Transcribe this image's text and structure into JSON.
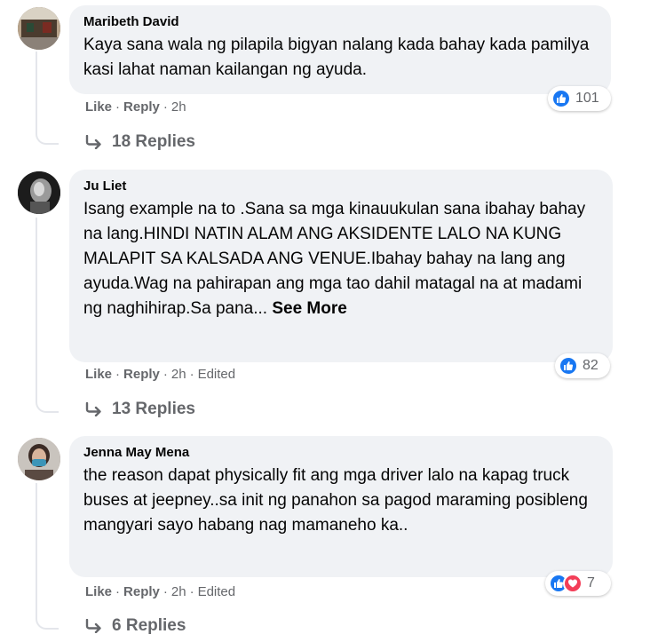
{
  "comments": [
    {
      "author": "Maribeth David",
      "text": "Kaya sana wala ng pilapila bigyan nalang kada bahay kada pamilya kasi lahat naman kailangan ng ayuda.",
      "see_more": "",
      "reactions": {
        "types": [
          "like"
        ],
        "count": "101"
      },
      "actions": {
        "like": "Like",
        "reply": "Reply",
        "time": "2h",
        "edited": ""
      },
      "replies": "18 Replies"
    },
    {
      "author": "Ju Liet",
      "text": "Isang example na to .Sana sa mga kinauukulan sana ibahay bahay na lang.HINDI NATIN ALAM ANG AKSIDENTE LALO NA KUNG MALAPIT SA KALSADA ANG VENUE.Ibahay bahay na lang ang ayuda.Wag na pahirapan ang mga tao dahil matagal na at madami ng naghihirap.Sa pana...",
      "see_more": "See More",
      "reactions": {
        "types": [
          "like"
        ],
        "count": "82"
      },
      "actions": {
        "like": "Like",
        "reply": "Reply",
        "time": "2h",
        "edited": "Edited"
      },
      "replies": "13 Replies"
    },
    {
      "author": "Jenna May Mena",
      "text": "the reason dapat physically fit ang mga driver lalo na kapag truck buses at jeepney..sa init ng panahon sa pagod maraming posibleng mangyari sayo habang nag mamaneho ka..",
      "see_more": "",
      "reactions": {
        "types": [
          "like",
          "love"
        ],
        "count": "7"
      },
      "actions": {
        "like": "Like",
        "reply": "Reply",
        "time": "2h",
        "edited": "Edited"
      },
      "replies": "6 Replies"
    }
  ],
  "colors": {
    "bubble": "#f0f2f5",
    "secondary_text": "#65676b",
    "like_blue": "#1877f2",
    "love_red": "#f33e58"
  }
}
